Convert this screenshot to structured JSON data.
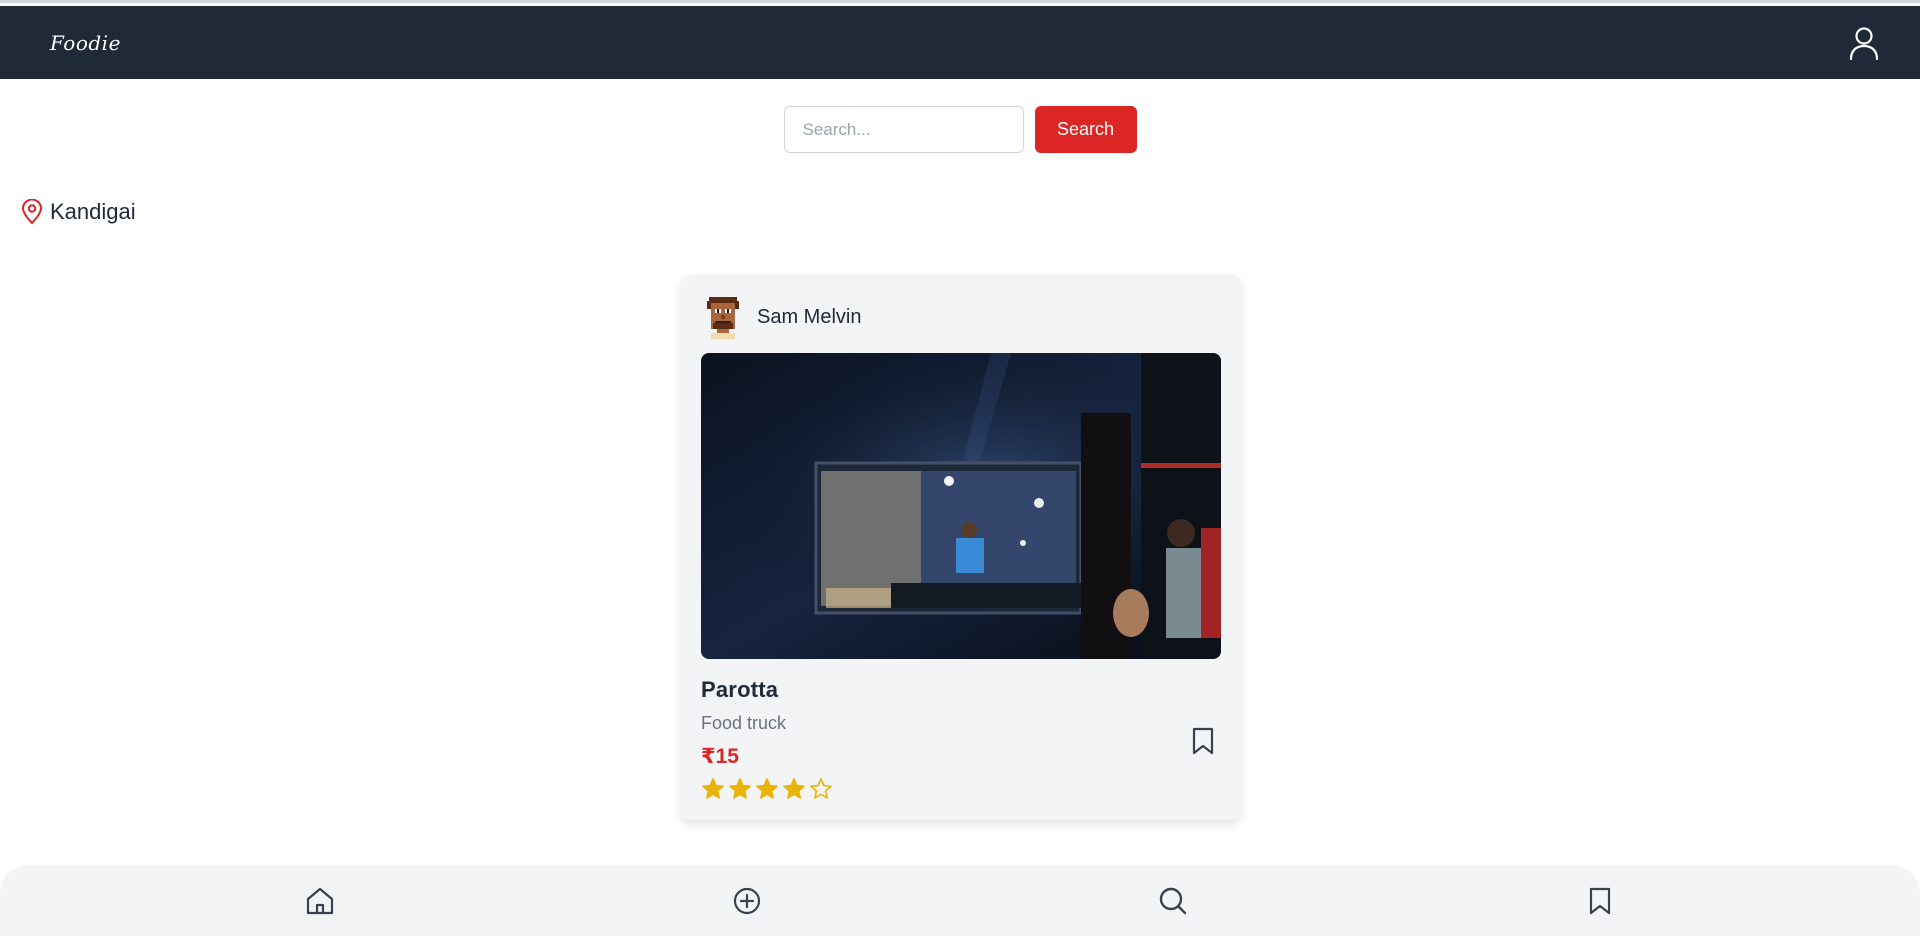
{
  "navbar": {
    "brand": "Foodie",
    "profile_icon": "user-icon"
  },
  "search": {
    "placeholder": "Search...",
    "value": "",
    "button_label": "Search"
  },
  "location": {
    "icon": "map-pin-icon",
    "name": "Kandigai"
  },
  "post": {
    "author": "Sam Melvin",
    "avatar_icon": "pixel-avatar-icon",
    "food_name": "Parotta",
    "food_type": "Food truck",
    "price": "₹15",
    "rating": 4,
    "rating_max": 5,
    "bookmark_icon": "bookmark-icon"
  },
  "bottom_nav": {
    "items": [
      "home-icon",
      "add-icon",
      "search-icon",
      "bookmark-icon"
    ]
  },
  "colors": {
    "navbar_bg": "#1f2937",
    "accent": "#dc2626",
    "star": "#eab308",
    "card_bg": "#f3f4f6"
  }
}
